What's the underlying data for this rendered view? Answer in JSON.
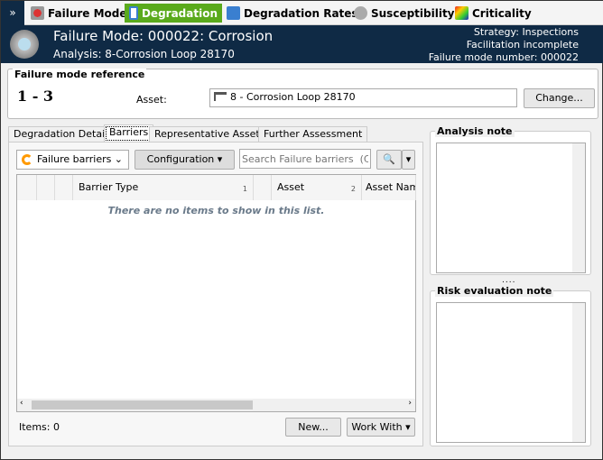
{
  "nav": {
    "tabs": [
      "Failure Mode",
      "Degradation",
      "Degradation Rates",
      "Susceptibility",
      "Criticality"
    ],
    "active": 1,
    "active_color": "#5aaa1c"
  },
  "header": {
    "title": "Failure Mode: 000022: Corrosion",
    "analysis": "Analysis: 8-Corrosion Loop 28170",
    "strategy": "Strategy: Inspections",
    "facilitation": "Facilitation incomplete",
    "fm_number": "Failure mode number: 000022"
  },
  "reference": {
    "legend": "Failure mode reference",
    "code": "1 - 3",
    "asset_label": "Asset:",
    "asset_value": "8 - Corrosion Loop 28170",
    "change": "Change..."
  },
  "tabs": [
    "Degradation Details",
    "Barriers",
    "Representative Assets",
    "Further Assessment"
  ],
  "toolbar": {
    "filter": "Failure barriers",
    "configuration": "Configuration",
    "search_placeholder": "Search Failure barriers  (Ctrl+"
  },
  "grid": {
    "columns": [
      "Barrier Type",
      "Asset",
      "Asset Nam"
    ],
    "sort": [
      "1",
      "2"
    ],
    "empty": "There are no items to show in this list."
  },
  "footer": {
    "items": "Items: 0",
    "new": "New...",
    "work_with": "Work With"
  },
  "notes": {
    "analysis": "Analysis note",
    "risk": "Risk evaluation note"
  }
}
